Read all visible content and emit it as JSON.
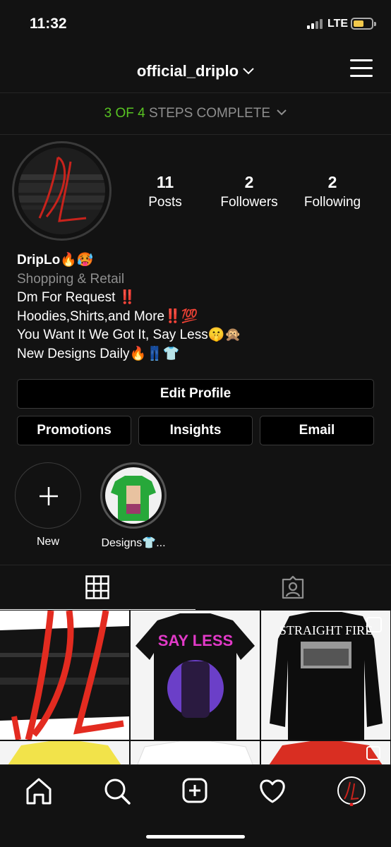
{
  "status_bar": {
    "time": "11:32",
    "network": "LTE",
    "icons": [
      "signal-icon",
      "battery-icon"
    ]
  },
  "header": {
    "username": "official_driplo",
    "icons": [
      "chevron-down-icon",
      "menu-icon"
    ]
  },
  "steps": {
    "count_text": "3 OF 4",
    "label": "STEPS COMPLETE",
    "accent_color": "#58c322"
  },
  "profile": {
    "avatar_text": "DL",
    "stats": [
      {
        "value": "11",
        "label": "Posts"
      },
      {
        "value": "2",
        "label": "Followers"
      },
      {
        "value": "2",
        "label": "Following"
      }
    ]
  },
  "bio": {
    "name": "DripLo🔥🥵",
    "category": "Shopping & Retail",
    "lines": [
      "Dm For Request ‼️",
      "Hoodies,Shirts,and More‼️💯",
      "You Want It We Got It, Say Less🤫🙊",
      "New Designs Daily🔥👖👕"
    ]
  },
  "buttons": {
    "edit_profile": "Edit Profile",
    "promotions": "Promotions",
    "insights": "Insights",
    "email": "Email"
  },
  "highlights": [
    {
      "label": "New",
      "icon": "plus-icon"
    },
    {
      "label": "Designs👕...",
      "icon": "story-thumbnail"
    }
  ],
  "tabs": [
    {
      "name": "grid",
      "icon": "grid-icon",
      "active": true
    },
    {
      "name": "tagged",
      "icon": "tagged-user-icon",
      "active": false
    }
  ],
  "posts": [
    {
      "type": "logo",
      "text": "DL"
    },
    {
      "type": "tshirt",
      "text": "SAY LESS",
      "color": "#111111",
      "accent": "#e23ac8"
    },
    {
      "type": "longsleeve",
      "text": "STRAIGHT FIRE",
      "color": "#0d0d0d"
    },
    {
      "type": "tshirt",
      "color": "#f2e34a"
    },
    {
      "type": "hoodie",
      "color": "#f2f2f2"
    },
    {
      "type": "tshirt",
      "color": "#d92e22"
    }
  ],
  "bottom_nav": {
    "icons": [
      "home-icon",
      "search-icon",
      "new-post-icon",
      "activity-heart-icon",
      "profile-avatar-icon"
    ]
  },
  "colors": {
    "background": "#121212",
    "text": "#ffffff",
    "muted": "#8e8e8e",
    "border": "#3a3a3a",
    "brand_red": "#e02020"
  }
}
